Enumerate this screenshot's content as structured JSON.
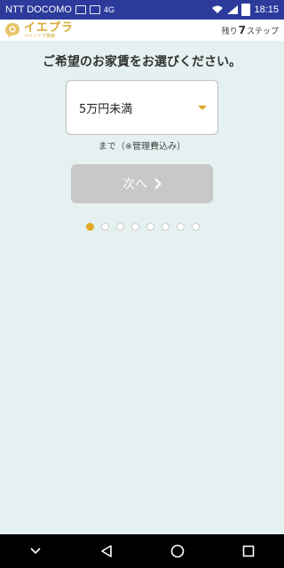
{
  "status_bar": {
    "carrier": "NTT DOCOMO",
    "network_badge": "4G",
    "time": "18:15"
  },
  "header": {
    "logo_text": "イエプラ",
    "logo_subtext": "ペイントで検索",
    "steps_prefix": "残り",
    "steps_count": "7",
    "steps_suffix": "ステップ"
  },
  "main": {
    "title": "ご希望のお家賃をお選びください。",
    "rent_select": {
      "selected_value": "5万円未満"
    },
    "note": "まで（※管理費込み）",
    "next_button_label": "次へ"
  },
  "progress": {
    "total_steps": 8,
    "current_step": 1
  },
  "colors": {
    "accent": "#e0a825",
    "status_bar": "#2b3a9b",
    "background": "#e5f1f0",
    "button_disabled": "#c8c8c8"
  }
}
